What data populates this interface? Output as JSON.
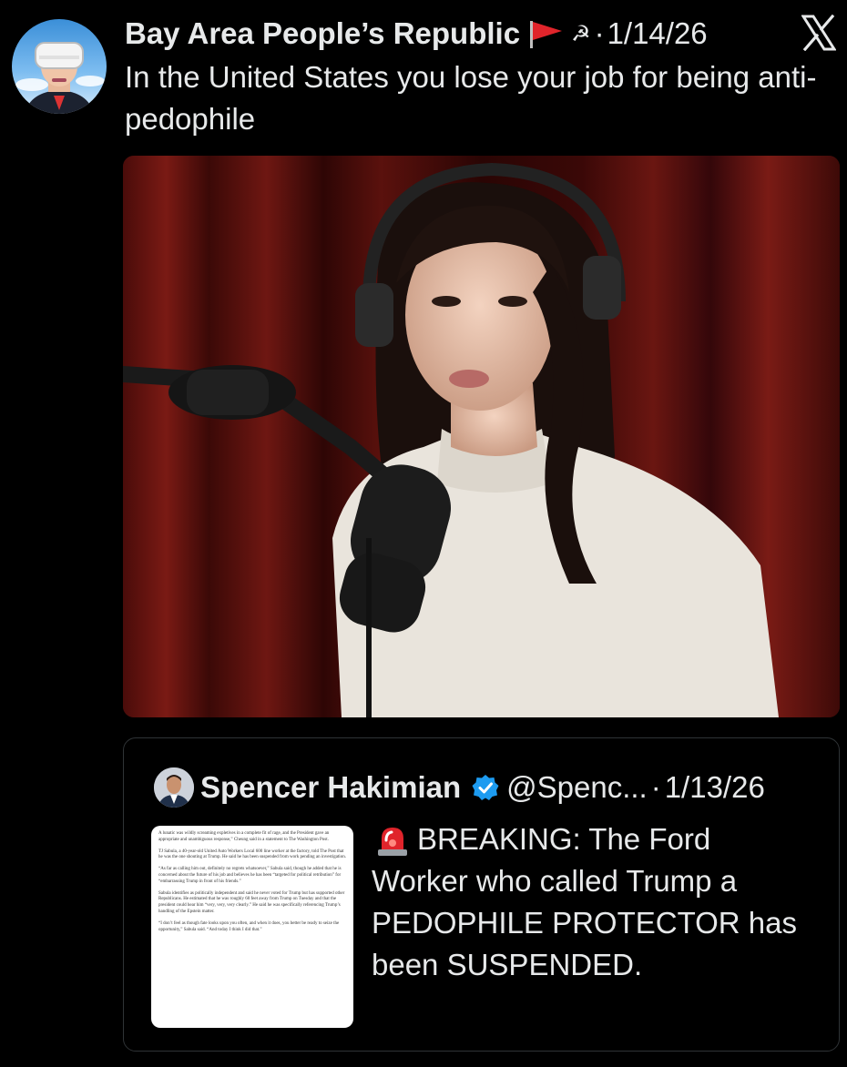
{
  "post": {
    "author": "Bay Area People’s Republic",
    "hammer_sickle": "☭",
    "separator": "·",
    "date": "1/14/26",
    "text": "In the United States you lose your job for being anti-pedophile"
  },
  "media": {
    "icon": "photo"
  },
  "quote": {
    "author": "Spencer Hakimian",
    "handle": "@Spenc...",
    "separator": "·",
    "date": "1/13/26",
    "text": "BREAKING: The Ford Worker who called Trump a PEDOPHILE PROTECTOR has been SUSPENDED.",
    "thumbnail_paragraphs": [
      "A lunatic was wildly screaming expletives in a complete fit of rage, and the President gave an appropriate and unambiguous response,” Cheung said in a statement to The Washington Post.",
      "TJ Sabula, a 40-year-old United Auto Workers Local 600 line worker at the factory, told The Post that he was the one shouting at Trump. He said he has been suspended from work pending an investigation.",
      "“As far as calling him out, definitely no regrets whatsoever,” Sabula said, though he added that he is concerned about the future of his job and believes he has been “targeted for political retribution” for “embarrassing Trump in front of his friends.”",
      "Sabula identifies as politically independent and said he never voted for Trump but has supported other Republicans. He estimated that he was roughly 60 feet away from Trump on Tuesday and that the president could hear him “very, very, very clearly.” He said he was specifically referencing Trump’s handling of the Epstein matter.",
      "“I don’t feel as though fate looks upon you often, and when it does, you better be ready to seize the opportunity,” Sabula said. “And today I think I did that.”"
    ]
  },
  "icons": {
    "avatar": "vr-headset-avatar-icon",
    "flag": "red-flag-icon",
    "logo": "x-logo-icon",
    "verified": "verified-badge-icon",
    "siren": "police-siren-icon"
  },
  "colors": {
    "background": "#000000",
    "text": "#e7e9ea",
    "verified": "#1d9bf0",
    "flag": "#e0242b",
    "border": "#2f3336"
  }
}
